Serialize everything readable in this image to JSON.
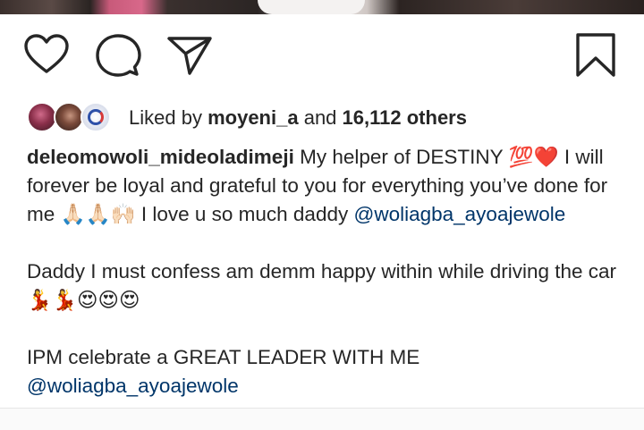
{
  "post": {
    "liked_by": {
      "prefix": "Liked by",
      "user": "moyeni_a",
      "joiner": "and",
      "others": "16,112 others"
    },
    "caption": {
      "username": "deleomowoli_mideoladimeji",
      "line1_text": "My helper of DESTINY",
      "line1_emoji": "💯❤️",
      "line1_tail": "I will forever be loyal and grateful to you for everything you’ve done for me",
      "line1_emoji2": "🙏🏻🙏🏻🙌🏻",
      "line1_tail2": "I love u so much daddy",
      "mention1": "@woliagba_ayoajewole",
      "para2_text": "Daddy I must confess am demm happy within while driving the car",
      "para2_emoji": "💃💃😍😍😍",
      "para3_text": "IPM celebrate a GREAT LEADER WITH ME",
      "mention2": "@woliagba_ayoajewole"
    }
  },
  "icons": {
    "like": "heart-outline-icon",
    "comment": "speech-bubble-icon",
    "share": "paper-plane-icon",
    "save": "bookmark-icon"
  },
  "colors": {
    "text": "#262626",
    "mention": "#003569",
    "background": "#ffffff"
  }
}
